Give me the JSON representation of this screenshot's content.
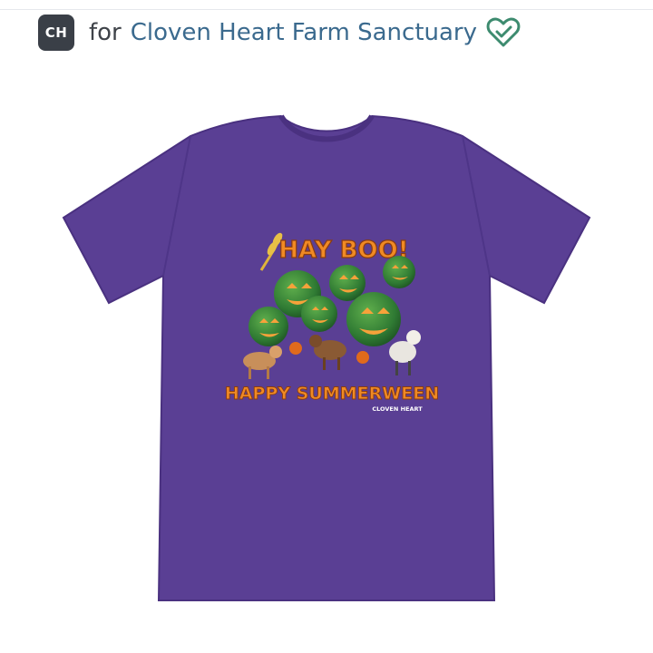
{
  "header": {
    "avatar_initials": "CH",
    "for_label": "for",
    "organization_name": "Cloven Heart Farm Sanctuary",
    "verified_icon": "heart-check-icon"
  },
  "product": {
    "shirt_color": "#5a3f94",
    "design": {
      "headline": "HAY BOO!",
      "subline": "HAPPY SUMMERWEEN",
      "brand_mark": "CLOVEN HEART"
    }
  },
  "colors": {
    "link": "#3b6a8e",
    "verified": "#3d8b6f",
    "design_orange": "#f08a24"
  }
}
